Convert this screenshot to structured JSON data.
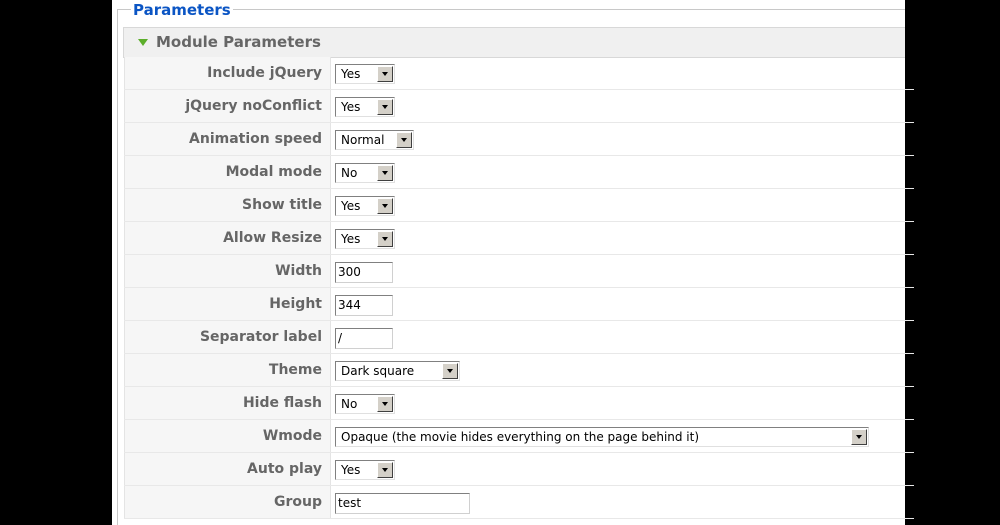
{
  "fieldset": {
    "legend": "Parameters"
  },
  "module": {
    "title": "Module Parameters"
  },
  "params": [
    {
      "label": "Include jQuery",
      "type": "select",
      "value": "Yes"
    },
    {
      "label": "jQuery noConflict",
      "type": "select",
      "value": "Yes"
    },
    {
      "label": "Animation speed",
      "type": "select",
      "value": "Normal"
    },
    {
      "label": "Modal mode",
      "type": "select",
      "value": "No"
    },
    {
      "label": "Show title",
      "type": "select",
      "value": "Yes"
    },
    {
      "label": "Allow Resize",
      "type": "select",
      "value": "Yes"
    },
    {
      "label": "Width",
      "type": "text",
      "value": "300"
    },
    {
      "label": "Height",
      "type": "text",
      "value": "344"
    },
    {
      "label": "Separator label",
      "type": "text",
      "value": "/"
    },
    {
      "label": "Theme",
      "type": "select",
      "value": "Dark square"
    },
    {
      "label": "Hide flash",
      "type": "select",
      "value": "No"
    },
    {
      "label": "Wmode",
      "type": "select",
      "value": "Opaque (the movie hides everything on the page behind it)"
    },
    {
      "label": "Auto play",
      "type": "select",
      "value": "Yes"
    },
    {
      "label": "Group",
      "type": "text",
      "value": "test"
    }
  ],
  "colors": {
    "legend": "#0b55c4",
    "toggle_arrow": "#5cae2b",
    "label_text": "#666666"
  },
  "icons": {
    "toggle": "triangle-down-icon",
    "dropdown": "chevron-down-icon"
  }
}
